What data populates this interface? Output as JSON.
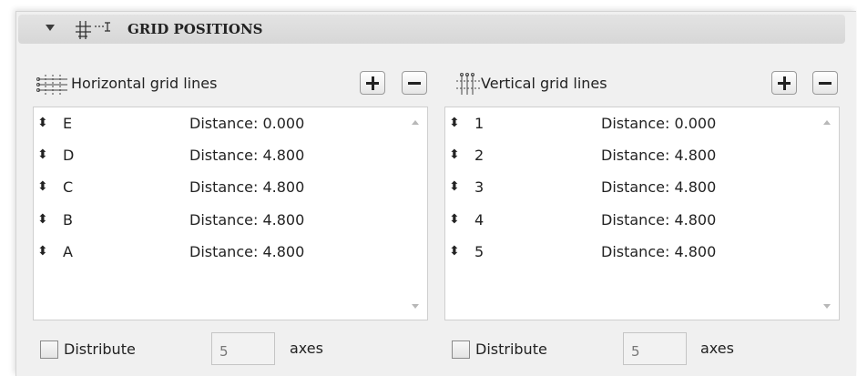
{
  "header": {
    "title": "GRID POSITIONS",
    "expand_icon": "triangle-down",
    "icon": "grid-positions-icon"
  },
  "horizontal": {
    "title": "Horizontal grid lines",
    "icon": "horizontal-grid-lines-icon",
    "add_button": "+",
    "remove_button": "−",
    "rows": [
      {
        "name": "E",
        "distance": "Distance: 0.000"
      },
      {
        "name": "D",
        "distance": "Distance: 4.800"
      },
      {
        "name": "C",
        "distance": "Distance: 4.800"
      },
      {
        "name": "B",
        "distance": "Distance: 4.800"
      },
      {
        "name": "A",
        "distance": "Distance: 4.800"
      }
    ],
    "distribute_label": "Distribute",
    "distribute_checked": false,
    "axes_value": "5",
    "axes_label": "axes"
  },
  "vertical": {
    "title": "Vertical grid lines",
    "icon": "vertical-grid-lines-icon",
    "add_button": "+",
    "remove_button": "−",
    "rows": [
      {
        "name": "1",
        "distance": "Distance: 0.000"
      },
      {
        "name": "2",
        "distance": "Distance: 4.800"
      },
      {
        "name": "3",
        "distance": "Distance: 4.800"
      },
      {
        "name": "4",
        "distance": "Distance: 4.800"
      },
      {
        "name": "5",
        "distance": "Distance: 4.800"
      }
    ],
    "distribute_label": "Distribute",
    "distribute_checked": false,
    "axes_value": "5",
    "axes_label": "axes"
  },
  "handle_glyph": "⬍",
  "colors": {
    "panel_bg": "#f0f0f0",
    "header_bg": "#d9d9d9",
    "list_bg": "#ffffff",
    "text": "#222222"
  }
}
